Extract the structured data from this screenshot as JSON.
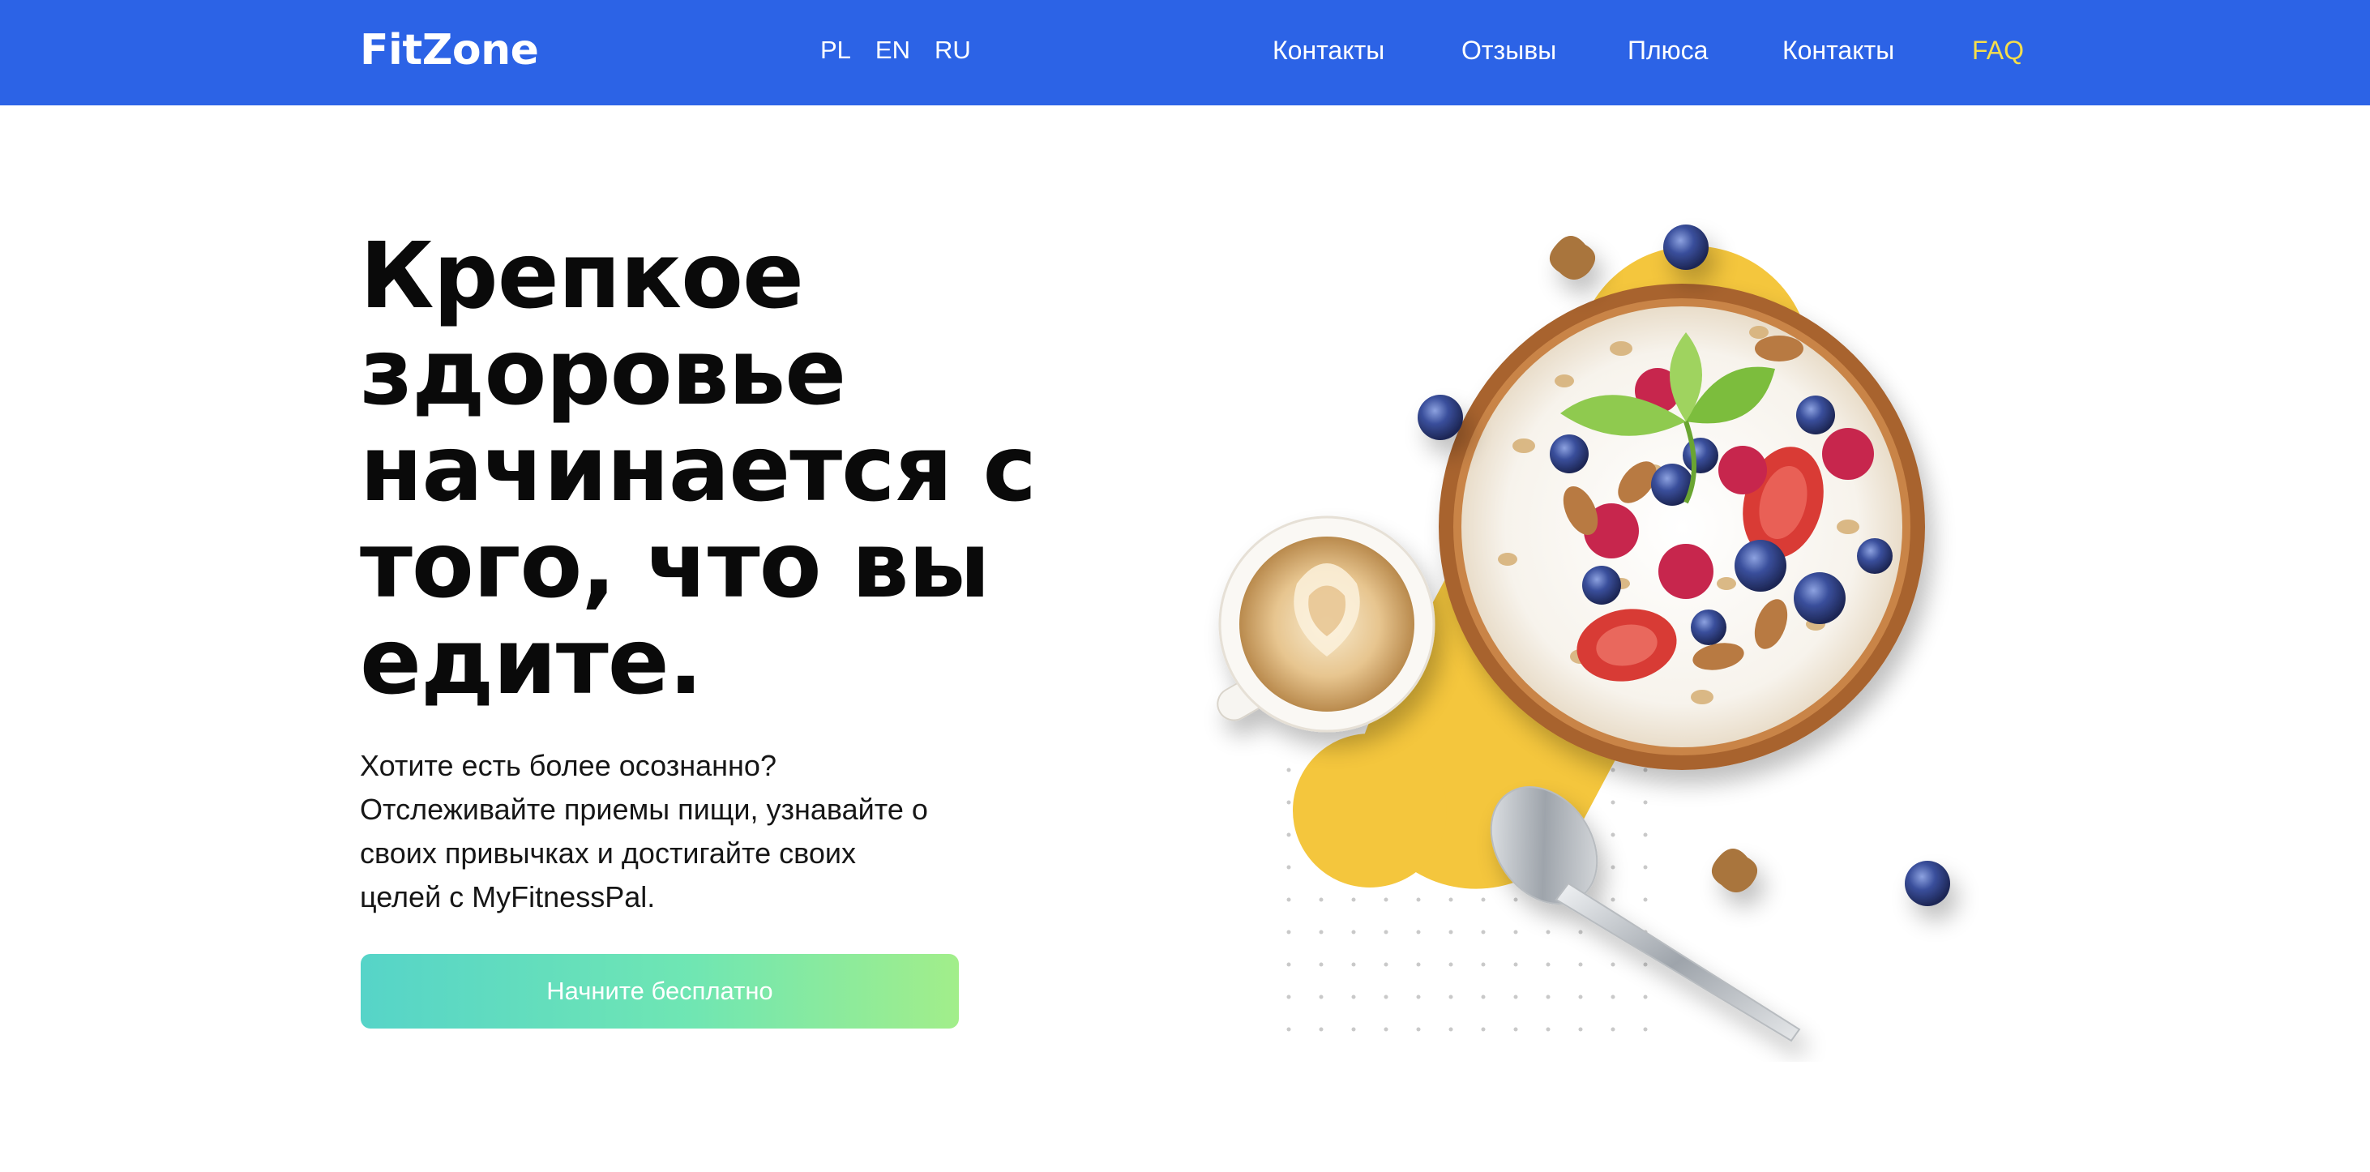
{
  "header": {
    "logo": "FitZone",
    "languages": [
      "PL",
      "EN",
      "RU"
    ],
    "nav": [
      "Контакты",
      "Отзывы",
      "Плюса",
      "Контакты",
      "FAQ"
    ]
  },
  "hero": {
    "title_lines": [
      "Крепкое",
      "здоровье",
      "начинается с",
      "того, что вы",
      "едите."
    ],
    "description_lines": [
      "Хотите есть более осознанно?",
      "Отслеживайте приемы пищи, узнавайте о",
      "своих привычках и достигайте своих",
      "целей с MyFitnessPal."
    ],
    "cta_label": "Начните бесплатно"
  },
  "colors": {
    "header_bg": "#2c63e6",
    "nav_active": "#f6de4b",
    "cta_gradient_start": "#56d4c8",
    "cta_gradient_end": "#a2ee8a",
    "accent_shape": "#f4c63d"
  },
  "illustration": {
    "items": [
      "yellow-blob",
      "cereal-bowl",
      "coffee-cup",
      "spoon",
      "blueberries",
      "walnuts",
      "mint-leaves",
      "strawberries",
      "raspberries",
      "almonds",
      "dot-grid"
    ]
  }
}
